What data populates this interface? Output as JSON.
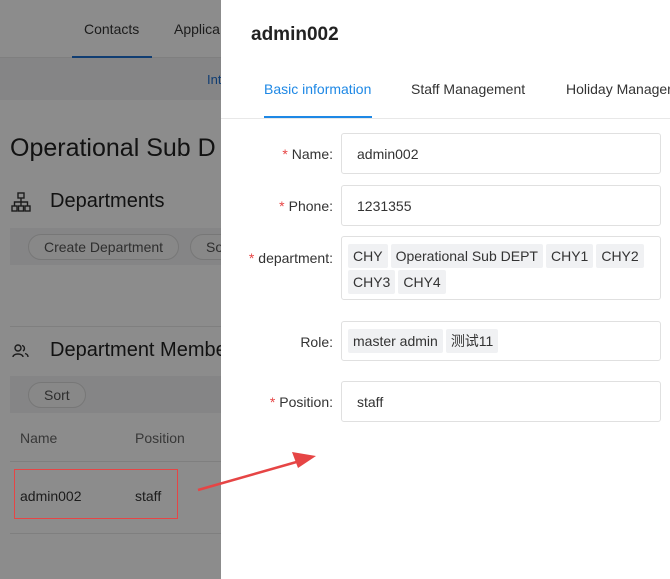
{
  "background": {
    "top_tabs": [
      {
        "label": "Contacts",
        "active": true
      },
      {
        "label": "Applica",
        "active": false
      }
    ],
    "sub_bar_text": "Int",
    "page_title": "Operational Sub D",
    "departments": {
      "title": "Departments",
      "icon": "org-chart-icon",
      "buttons": [
        "Create Department",
        "So"
      ]
    },
    "members": {
      "title": "Department Membe",
      "icon": "users-icon",
      "sort_label": "Sort",
      "columns": [
        "Name",
        "Position"
      ],
      "rows": [
        {
          "name": "admin002",
          "position": "staff"
        }
      ]
    }
  },
  "drawer": {
    "title": "admin002",
    "tabs": [
      {
        "label": "Basic information",
        "active": true
      },
      {
        "label": "Staff Management",
        "active": false
      },
      {
        "label": "Holiday Manager",
        "active": false
      }
    ],
    "form": {
      "name": {
        "label": "Name:",
        "required": true,
        "value": "admin002"
      },
      "phone": {
        "label": "Phone:",
        "required": true,
        "value": "1231355"
      },
      "department": {
        "label": "department:",
        "required": true,
        "tags": [
          "CHY",
          "Operational Sub DEPT",
          "CHY1",
          "CHY2",
          "CHY3",
          "CHY4"
        ]
      },
      "role": {
        "label": "Role:",
        "required": false,
        "tags": [
          "master admin",
          "测试11"
        ]
      },
      "position": {
        "label": "Position:",
        "required": true,
        "value": "staff"
      }
    }
  },
  "colors": {
    "accent": "#1e88e5",
    "required": "#e64545",
    "annotation": "#e64545"
  }
}
